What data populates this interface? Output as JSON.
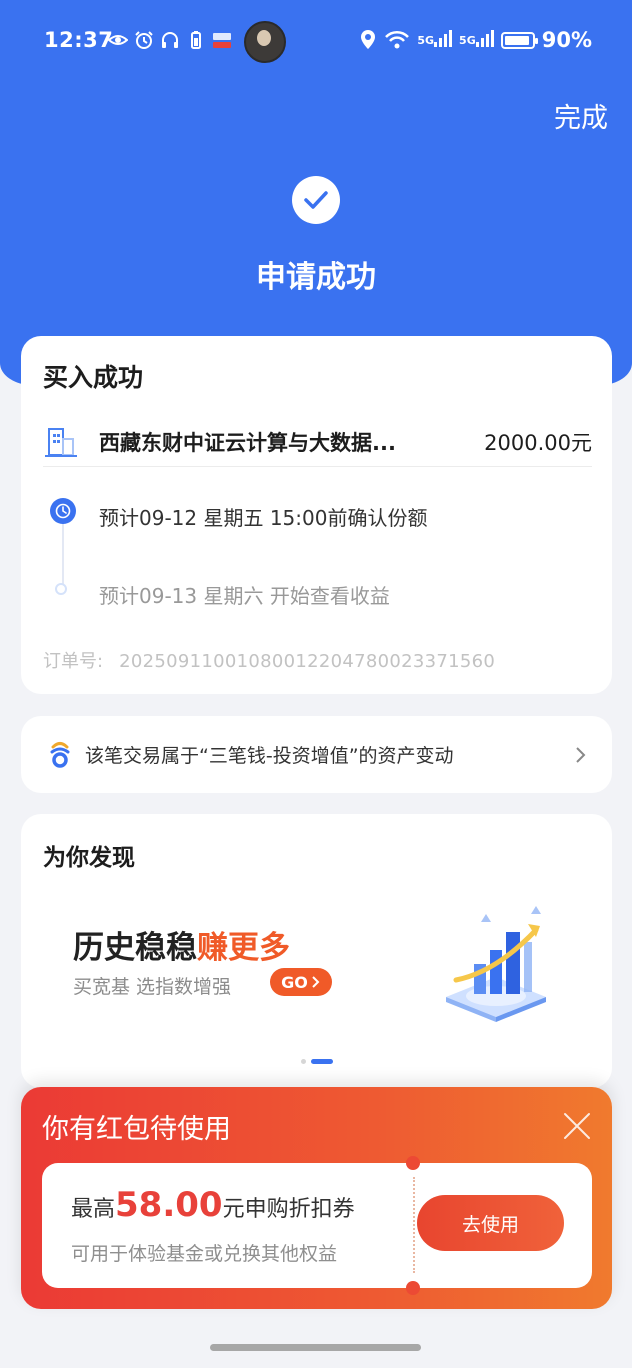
{
  "status_bar": {
    "time": "12:37",
    "battery": "90%",
    "network_label_1": "5G",
    "network_label_2": "5G"
  },
  "header": {
    "done_label": "完成",
    "title": "申请成功"
  },
  "purchase_card": {
    "title": "买入成功",
    "fund_name": "西藏东财中证云计算与大数据...",
    "amount": "2000.00元",
    "steps": [
      {
        "text": "预计09-12 星期五 15:00前确认份额"
      },
      {
        "text": "预计09-13 星期六 开始查看收益"
      }
    ],
    "order_label": "订单号:",
    "order_number": "20250911001080012204780023371560"
  },
  "asset_link": {
    "text": "该笔交易属于“三笔钱-投资增值”的资产变动"
  },
  "discover": {
    "title": "为你发现",
    "banner_title_plain": "历史稳稳",
    "banner_title_highlight": "赚更多",
    "banner_subtitle": "买宽基 选指数增强",
    "banner_button": "GO"
  },
  "red_packet": {
    "title": "你有红包待使用",
    "prefix": "最高",
    "amount": "58.00",
    "suffix": "元申购折扣券",
    "description": "可用于体验基金或兑换其他权益",
    "use_button": "去使用"
  },
  "colors": {
    "brand_blue": "#3a72f0",
    "accent_orange": "#f05a28",
    "coupon_red": "#e8413a"
  }
}
